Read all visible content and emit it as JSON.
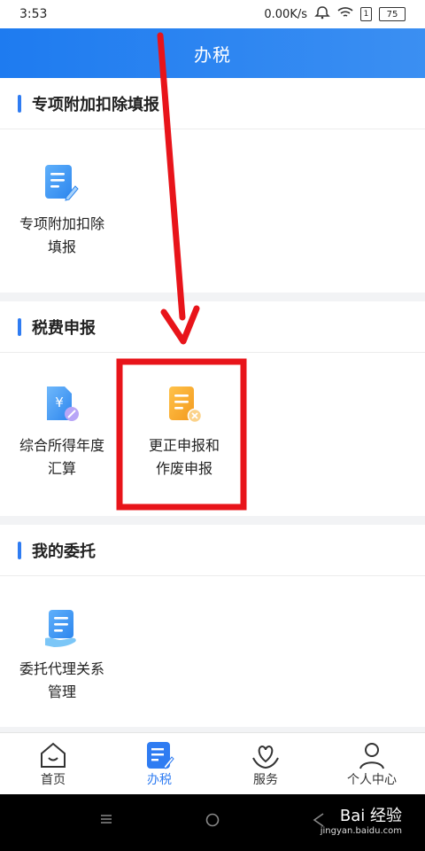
{
  "status_bar": {
    "time": "3:53",
    "speed": "0.00K/s",
    "sim_label": "1",
    "battery": "75"
  },
  "header": {
    "title": "办税"
  },
  "sections": [
    {
      "title": "专项附加扣除填报",
      "tiles": [
        {
          "line1": "专项附加扣除",
          "line2": "填报",
          "icon": "document-edit-icon"
        }
      ]
    },
    {
      "title": "税费申报",
      "tiles": [
        {
          "line1": "综合所得年度",
          "line2": "汇算",
          "icon": "yen-document-icon"
        },
        {
          "line1": "更正申报和",
          "line2": "作废申报",
          "icon": "document-cancel-icon"
        }
      ]
    },
    {
      "title": "我的委托",
      "tiles": [
        {
          "line1": "委托代理关系",
          "line2": "管理",
          "icon": "document-hand-icon"
        }
      ]
    }
  ],
  "bottom_nav": [
    {
      "label": "首页",
      "icon": "home-icon"
    },
    {
      "label": "办税",
      "icon": "tax-document-icon",
      "active": true
    },
    {
      "label": "服务",
      "icon": "heart-hands-icon"
    },
    {
      "label": "个人中心",
      "icon": "person-icon"
    }
  ],
  "watermark": {
    "brand": "Bai 经验",
    "url": "jingyan.baidu.com"
  },
  "colors": {
    "accent": "#2f7cf2",
    "header_gradient_start": "#1e7bf0",
    "annotation_red": "#e8141a",
    "orange_icon": "#f5a623"
  }
}
